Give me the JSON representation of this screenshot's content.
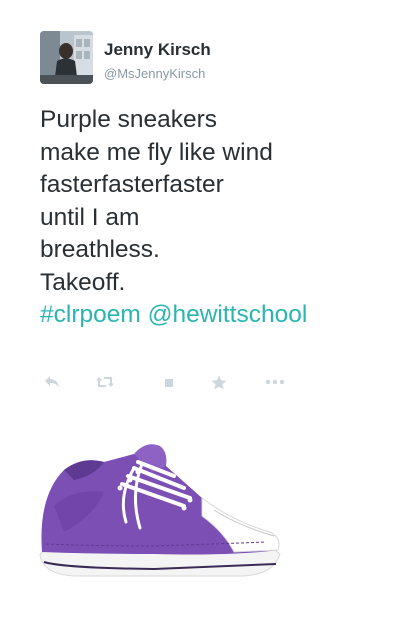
{
  "tweet": {
    "author": {
      "name": "Jenny Kirsch",
      "handle": "@MsJennyKirsch"
    },
    "text_lines": [
      "Purple sneakers",
      "make me fly like wind",
      "fasterfasterfaster",
      "until I am",
      "breathless.",
      "Takeoff."
    ],
    "hashtag": "#clrpoem",
    "mention": "@hewittschool"
  },
  "actions": [
    {
      "icon": "reply-icon"
    },
    {
      "icon": "retweet-icon"
    },
    {
      "icon": "like-icon"
    },
    {
      "icon": "favorite-star-icon"
    },
    {
      "icon": "more-dots-icon"
    }
  ],
  "colors": {
    "text": "#292f33",
    "muted": "#8899a6",
    "link": "#2bb5b0",
    "action_icon": "#ccd6dd",
    "shoe": "#7b4fb4"
  }
}
